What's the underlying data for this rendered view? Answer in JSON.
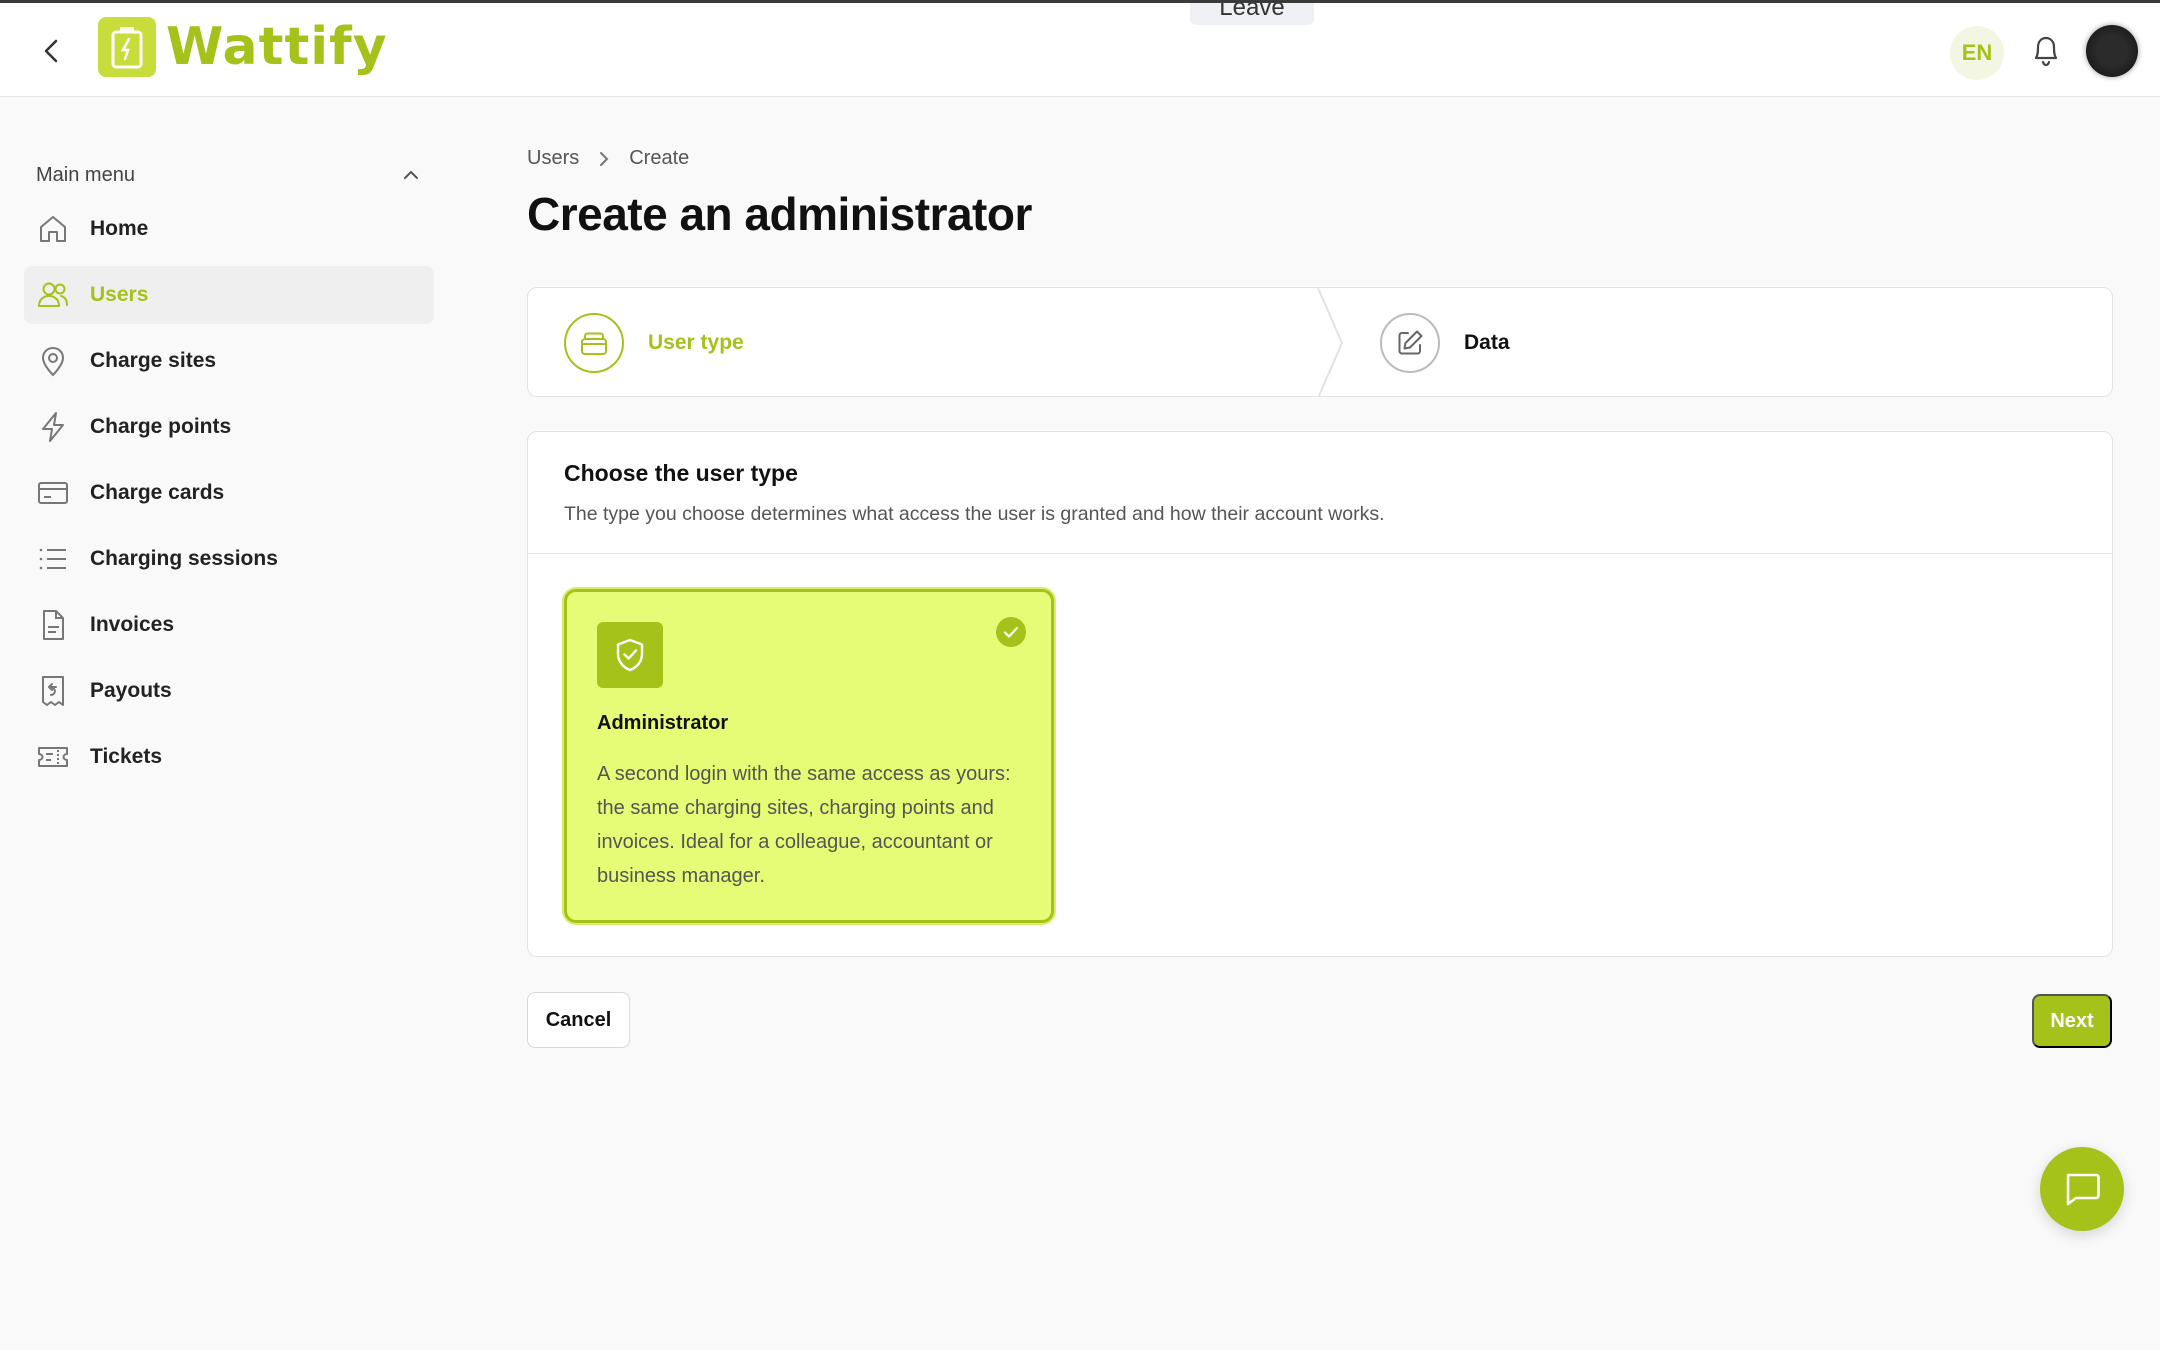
{
  "app": {
    "brand": "Wattify",
    "brand_color": "#a5c21b",
    "leave_label": "Leave"
  },
  "header": {
    "language": "EN"
  },
  "sidebar": {
    "menu_label": "Main menu",
    "items": [
      {
        "label": "Home",
        "icon": "home-icon"
      },
      {
        "label": "Users",
        "icon": "users-icon",
        "active": true
      },
      {
        "label": "Charge sites",
        "icon": "map-pin-icon"
      },
      {
        "label": "Charge points",
        "icon": "lightning-icon"
      },
      {
        "label": "Charge cards",
        "icon": "card-icon"
      },
      {
        "label": "Charging sessions",
        "icon": "list-icon"
      },
      {
        "label": "Invoices",
        "icon": "document-icon"
      },
      {
        "label": "Payouts",
        "icon": "receipt-icon"
      },
      {
        "label": "Tickets",
        "icon": "ticket-icon"
      }
    ]
  },
  "breadcrumb": {
    "items": [
      "Users",
      "Create"
    ]
  },
  "page": {
    "title": "Create an administrator"
  },
  "stepper": {
    "steps": [
      {
        "label": "User type",
        "status": "active"
      },
      {
        "label": "Data",
        "status": "pending"
      }
    ]
  },
  "panel": {
    "title": "Choose the user type",
    "subtitle": "The type you choose determines what access the user is granted and how their account works.",
    "options": [
      {
        "name": "Administrator",
        "description": "A second login with the same access as yours: the same charging sites, charging points and invoices. Ideal for a colleague, accountant or business manager.",
        "selected": true
      }
    ]
  },
  "actions": {
    "cancel": "Cancel",
    "next": "Next"
  }
}
